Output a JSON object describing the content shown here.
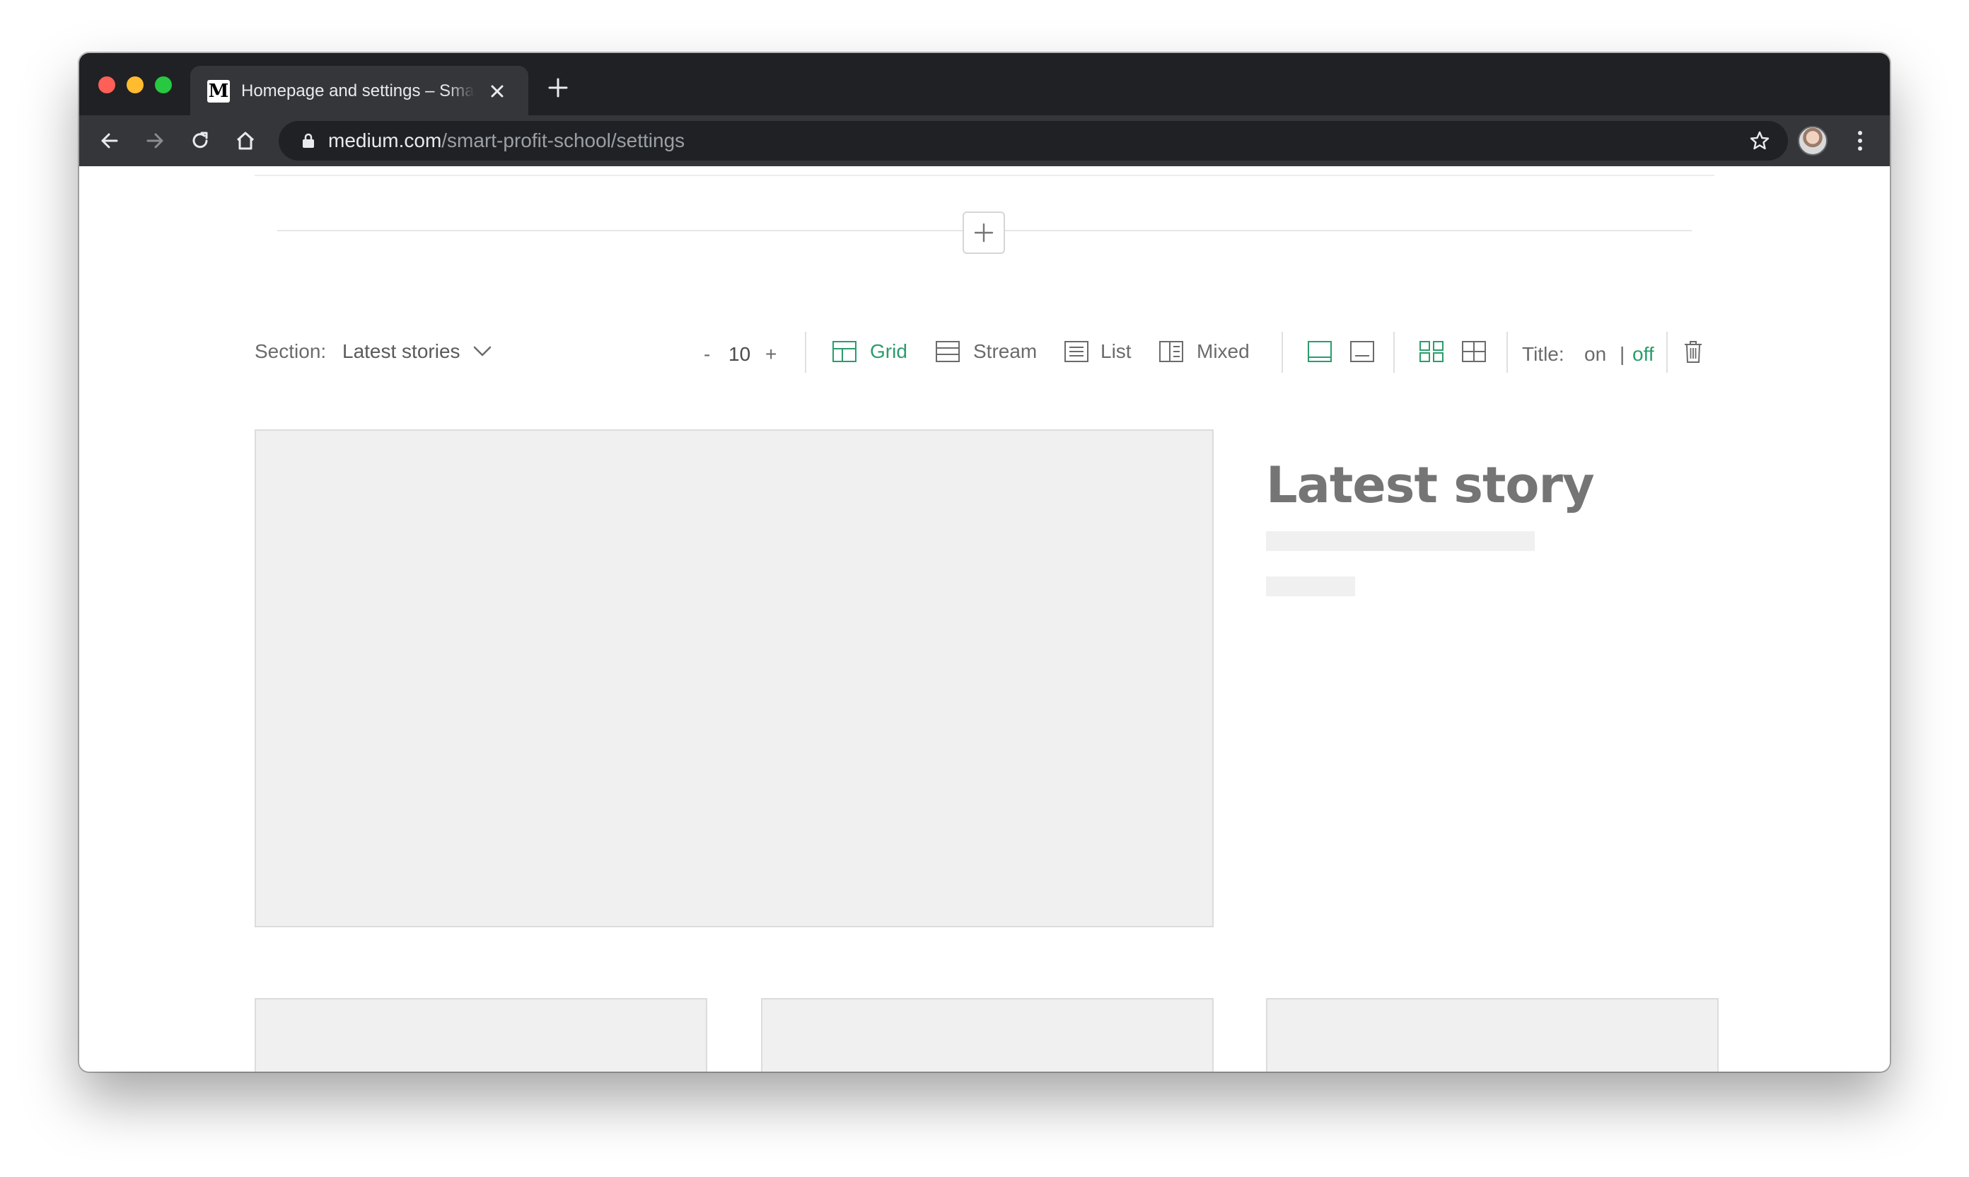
{
  "browser": {
    "tab": {
      "title": "Homepage and settings – Smart Profit School",
      "favicon_letter": "M"
    },
    "address_bar": {
      "host": "medium.com",
      "path": "/smart-profit-school/settings"
    },
    "icons": [
      "back-icon",
      "forward-icon",
      "reload-icon",
      "home-icon",
      "lock-icon",
      "star-icon",
      "kebab-menu-icon"
    ]
  },
  "section_controls": {
    "section_label": "Section:",
    "section_value": "Latest stories",
    "count_minus": "-",
    "count": "10",
    "count_plus": "+",
    "layouts": [
      {
        "label": "Grid",
        "selected": true
      },
      {
        "label": "Stream",
        "selected": false
      },
      {
        "label": "List",
        "selected": false
      },
      {
        "label": "Mixed",
        "selected": false
      }
    ],
    "title_label": "Title:",
    "title_on": "on",
    "title_separator": "|",
    "title_off": "off",
    "title_selected": "off"
  },
  "preview": {
    "headline": "Latest story"
  },
  "colors": {
    "accent_green": "#2a9d6c",
    "chrome_dark": "#202124",
    "placeholder_gray": "#f0f0f0"
  }
}
